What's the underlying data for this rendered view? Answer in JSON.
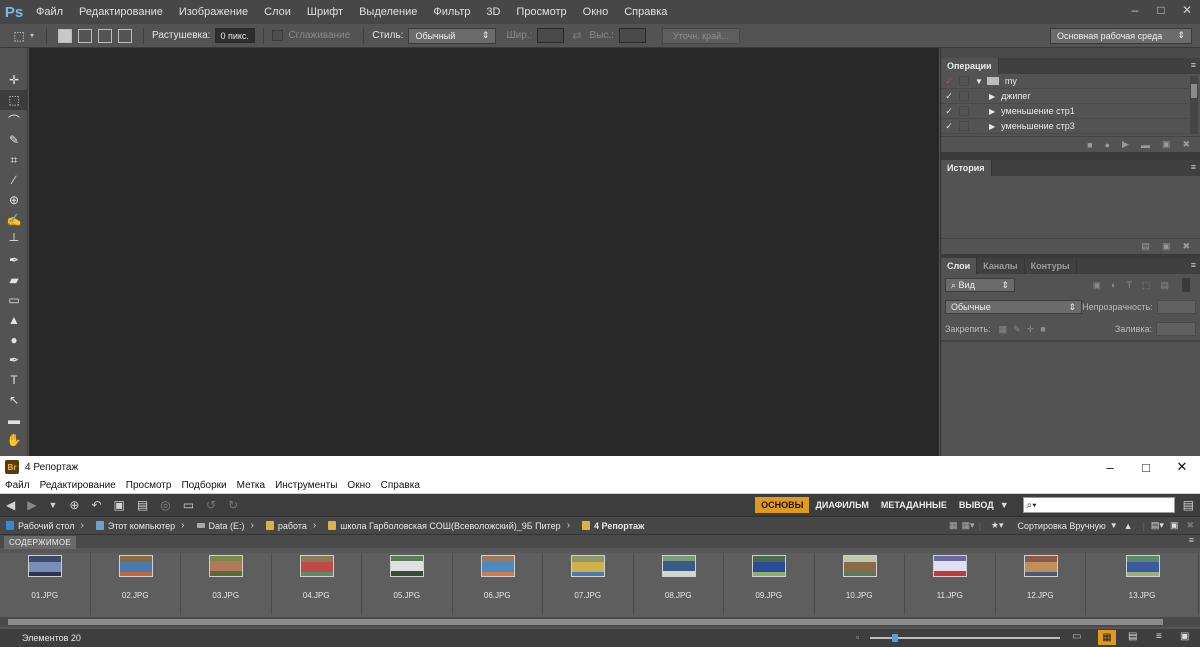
{
  "photoshop": {
    "logo": "Ps",
    "menu": [
      "Файл",
      "Редактирование",
      "Изображение",
      "Слои",
      "Шрифт",
      "Выделение",
      "Фильтр",
      "3D",
      "Просмотр",
      "Окно",
      "Справка"
    ],
    "options": {
      "feather_label": "Растушевка:",
      "feather_value": "0 пикс.",
      "antialias_label": "Сглаживание",
      "style_label": "Стиль:",
      "style_value": "Обычный",
      "width_label": "Шир.:",
      "height_label": "Выс.:",
      "refine_edge": "Уточн. край...",
      "workspace": "Основная рабочая среда"
    },
    "actions_panel": {
      "tab": "Операции",
      "rows": [
        {
          "label": "my",
          "is_set": true
        },
        {
          "label": "джипег",
          "is_set": false
        },
        {
          "label": "уменьшение стр1",
          "is_set": false
        },
        {
          "label": "уменьшение стр3",
          "is_set": false
        }
      ]
    },
    "history_panel": {
      "tab": "История"
    },
    "layers_panel": {
      "tabs": [
        "Слои",
        "Каналы",
        "Контуры"
      ],
      "filter_kind": "Вид",
      "blend_mode": "Обычные",
      "opacity_label": "Непрозрачность:",
      "lock_label": "Закрепить:",
      "fill_label": "Заливка:"
    }
  },
  "bridge": {
    "logo": "Br",
    "title": "4 Репортаж",
    "menu": [
      "Файл",
      "Редактирование",
      "Просмотр",
      "Подборки",
      "Метка",
      "Инструменты",
      "Окно",
      "Справка"
    ],
    "workspaces": [
      "ОСНОВЫ",
      "ДИАФИЛЬМ",
      "МЕТАДАННЫЕ",
      "ВЫВОД"
    ],
    "active_workspace": "ОСНОВЫ",
    "search_placeholder": "",
    "breadcrumbs": [
      "Рабочий стол",
      "Этот компьютер",
      "Data (E:)",
      "работа",
      "школа Гарболовская СОШ(Всеволожский)_9Б Питер",
      "4 Репортаж"
    ],
    "sort_label": "Сортировка Вручную",
    "content_tab": "СОДЕРЖИМОЕ",
    "thumbnails": [
      "01.JPG",
      "02.JPG",
      "03.JPG",
      "04.JPG",
      "05.JPG",
      "06.JPG",
      "07.JPG",
      "08.JPG",
      "09.JPG",
      "10.JPG",
      "11.JPG",
      "12.JPG",
      "13.JPG"
    ],
    "status": "Элементов 20",
    "thumb_zoom": 0.12
  },
  "colors": {
    "accent": "#e09a1e",
    "ps_dark": "#282828",
    "ps_panel": "#535353"
  }
}
